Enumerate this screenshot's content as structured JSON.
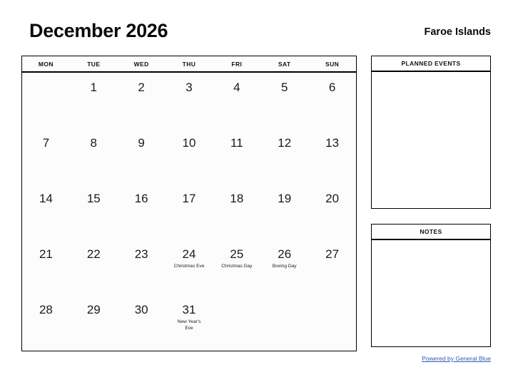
{
  "header": {
    "title": "December 2026",
    "region": "Faroe Islands"
  },
  "calendar": {
    "weekdays": [
      "MON",
      "TUE",
      "WED",
      "THU",
      "FRI",
      "SAT",
      "SUN"
    ],
    "weeks": [
      [
        {
          "day": "",
          "event": ""
        },
        {
          "day": "1",
          "event": ""
        },
        {
          "day": "2",
          "event": ""
        },
        {
          "day": "3",
          "event": ""
        },
        {
          "day": "4",
          "event": ""
        },
        {
          "day": "5",
          "event": ""
        },
        {
          "day": "6",
          "event": ""
        }
      ],
      [
        {
          "day": "7",
          "event": ""
        },
        {
          "day": "8",
          "event": ""
        },
        {
          "day": "9",
          "event": ""
        },
        {
          "day": "10",
          "event": ""
        },
        {
          "day": "11",
          "event": ""
        },
        {
          "day": "12",
          "event": ""
        },
        {
          "day": "13",
          "event": ""
        }
      ],
      [
        {
          "day": "14",
          "event": ""
        },
        {
          "day": "15",
          "event": ""
        },
        {
          "day": "16",
          "event": ""
        },
        {
          "day": "17",
          "event": ""
        },
        {
          "day": "18",
          "event": ""
        },
        {
          "day": "19",
          "event": ""
        },
        {
          "day": "20",
          "event": ""
        }
      ],
      [
        {
          "day": "21",
          "event": ""
        },
        {
          "day": "22",
          "event": ""
        },
        {
          "day": "23",
          "event": ""
        },
        {
          "day": "24",
          "event": "Christmas Eve"
        },
        {
          "day": "25",
          "event": "Christmas Day"
        },
        {
          "day": "26",
          "event": "Boxing Day"
        },
        {
          "day": "27",
          "event": ""
        }
      ],
      [
        {
          "day": "28",
          "event": ""
        },
        {
          "day": "29",
          "event": ""
        },
        {
          "day": "30",
          "event": ""
        },
        {
          "day": "31",
          "event": "New Year's\nEve"
        },
        {
          "day": "",
          "event": ""
        },
        {
          "day": "",
          "event": ""
        },
        {
          "day": "",
          "event": ""
        }
      ]
    ]
  },
  "panels": {
    "events_title": "PLANNED EVENTS",
    "notes_title": "NOTES"
  },
  "footer": {
    "link_text": "Powered by General Blue",
    "link_color": "#2a59c8"
  }
}
